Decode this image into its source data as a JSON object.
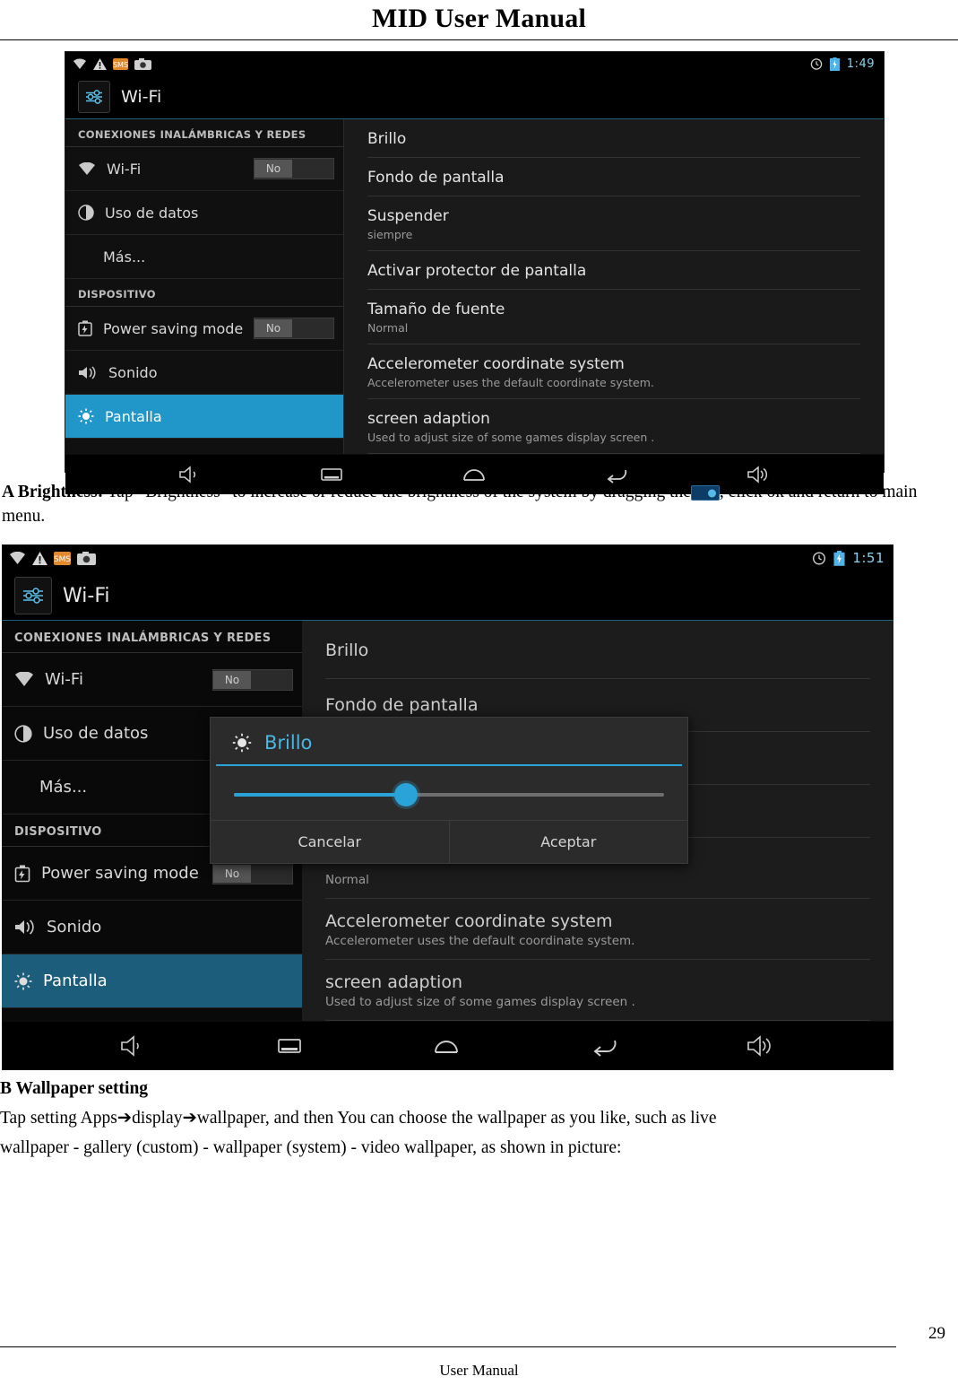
{
  "document": {
    "title": "MID User Manual",
    "footer": "User Manual",
    "page_number": "29"
  },
  "screenshot1": {
    "status_bar": {
      "time": "1:49",
      "icons": [
        "wifi-icon",
        "warning-icon",
        "sms-icon",
        "camera-icon",
        "alarm-icon",
        "battery-icon"
      ]
    },
    "app_title": "Wi-Fi",
    "left": {
      "section_wireless": "CONEXIONES INALÁMBRICAS Y REDES",
      "section_device": "DISPOSITIVO",
      "items": [
        {
          "label": "Wi-Fi",
          "toggle": "No",
          "icon": "wifi-icon"
        },
        {
          "label": "Uso de datos",
          "icon": "data-usage-icon"
        },
        {
          "label": "Más...",
          "icon": ""
        },
        {
          "label": "Power saving mode",
          "toggle": "No",
          "icon": "battery-saver-icon"
        },
        {
          "label": "Sonido",
          "icon": "sound-icon"
        },
        {
          "label": "Pantalla",
          "icon": "display-icon",
          "selected": true
        }
      ]
    },
    "right": {
      "items": [
        {
          "title": "Brillo",
          "sub": ""
        },
        {
          "title": "Fondo de pantalla",
          "sub": ""
        },
        {
          "title": "Suspender",
          "sub": "siempre"
        },
        {
          "title": "Activar protector de pantalla",
          "sub": ""
        },
        {
          "title": "Tamaño de fuente",
          "sub": "Normal"
        },
        {
          "title": "Accelerometer coordinate system",
          "sub": "Accelerometer uses the default coordinate system."
        },
        {
          "title": "screen adaption",
          "sub": "Used to adjust size of some games display screen ."
        }
      ]
    },
    "nav": [
      "volume-down-icon",
      "recents-icon",
      "home-icon",
      "back-icon",
      "volume-up-icon"
    ]
  },
  "paragraph_a": {
    "bold": "A Brightness:",
    "text_before": " Tap “Brightness” to increase or reduce the brightness of the system by dragging the",
    "text_after": ", click ok and return to main menu."
  },
  "screenshot2": {
    "status_bar": {
      "time": "1:51",
      "icons": [
        "wifi-icon",
        "warning-icon",
        "sms-icon",
        "camera-icon",
        "alarm-icon",
        "battery-icon"
      ]
    },
    "app_title": "Wi-Fi",
    "left": {
      "section_wireless": "CONEXIONES INALÁMBRICAS Y REDES",
      "section_device": "DISPOSITIVO",
      "items": [
        {
          "label": "Wi-Fi",
          "toggle": "No",
          "icon": "wifi-icon"
        },
        {
          "label": "Uso de datos",
          "icon": "data-usage-icon"
        },
        {
          "label": "Más...",
          "icon": ""
        },
        {
          "label": "Power saving mode",
          "toggle": "No",
          "icon": "battery-saver-icon"
        },
        {
          "label": "Sonido",
          "icon": "sound-icon"
        },
        {
          "label": "Pantalla",
          "icon": "display-icon",
          "selected": true
        }
      ]
    },
    "right": {
      "items": [
        {
          "title": "Brillo",
          "sub": ""
        },
        {
          "title": "Fondo de pantalla",
          "sub": ""
        },
        {
          "title": "",
          "sub": ""
        },
        {
          "title": "",
          "sub": ""
        },
        {
          "title": "",
          "sub": "Normal"
        },
        {
          "title": "Accelerometer coordinate system",
          "sub": "Accelerometer uses the default coordinate system."
        },
        {
          "title": "screen adaption",
          "sub": "Used to adjust size of some games display screen ."
        }
      ]
    },
    "dialog": {
      "title": "Brillo",
      "icon": "brightness-icon",
      "slider_percent": 40,
      "cancel_label": "Cancelar",
      "accept_label": "Aceptar"
    },
    "nav": [
      "volume-down-icon",
      "recents-icon",
      "home-icon",
      "back-icon",
      "volume-up-icon"
    ]
  },
  "paragraph_b": {
    "heading": "B Wallpaper setting",
    "line1": "Tap setting Apps➔display➔wallpaper, and then You can choose the wallpaper as you like, such as live",
    "line2": "wallpaper - gallery (custom) - wallpaper (system) - video wallpaper, as shown in picture:"
  }
}
